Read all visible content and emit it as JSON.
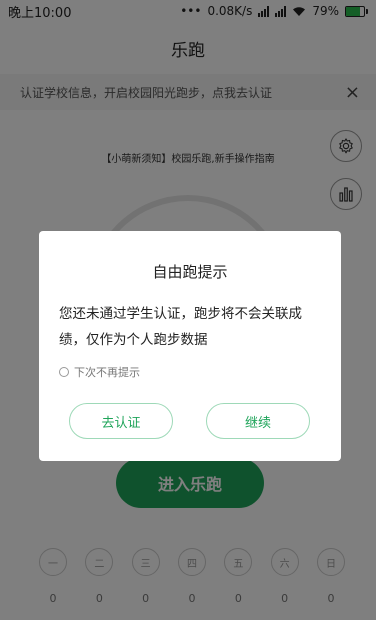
{
  "status_bar": {
    "time": "晚上10:00",
    "dots": "•••",
    "network_speed": "0.08K/s",
    "battery_percent": "79%",
    "battery_level": 0.79
  },
  "header": {
    "title": "乐跑"
  },
  "notice": {
    "text": "认证学校信息，开启校园阳光跑步，点我去认证",
    "close_icon": "×"
  },
  "guide_link": "【小萌新须知】校园乐跑,新手操作指南",
  "enter_run_label": "进入乐跑",
  "week": [
    {
      "day": "一",
      "count": "0"
    },
    {
      "day": "二",
      "count": "0"
    },
    {
      "day": "三",
      "count": "0"
    },
    {
      "day": "四",
      "count": "0"
    },
    {
      "day": "五",
      "count": "0"
    },
    {
      "day": "六",
      "count": "0"
    },
    {
      "day": "日",
      "count": "0"
    }
  ],
  "dialog": {
    "title": "自由跑提示",
    "message": "您还未通过学生认证，跑步将不会关联成绩，仅作为个人跑步数据",
    "checkbox_label": "下次不再提示",
    "verify_button": "去认证",
    "continue_button": "继续"
  },
  "colors": {
    "accent": "#1fa45a",
    "dialog_button_border": "#9ed9b8",
    "overlay": "rgba(0,0,0,0.5)"
  }
}
